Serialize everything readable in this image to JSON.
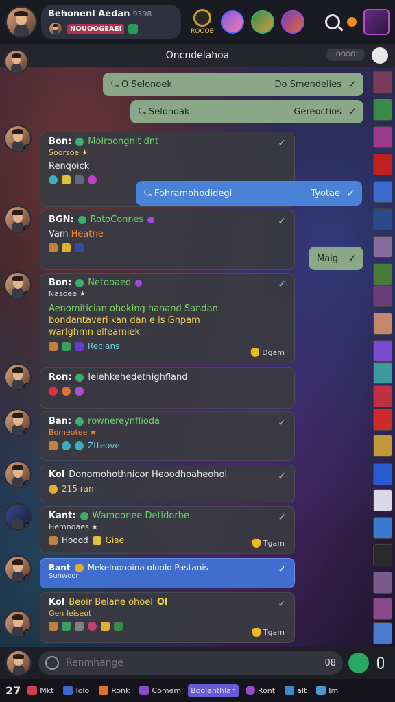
{
  "topbar": {
    "user_name": "Behonenl Aedan",
    "user_number": "9398",
    "user_badge": "NOUOOGEAEI",
    "coin_label": "ROOOB"
  },
  "header": {
    "title": "Oncndelahoa",
    "pill_text": "OOOO"
  },
  "messages": {
    "out1": {
      "left": "O Selonoek",
      "right": "Do Smendelies"
    },
    "out2": {
      "left": "Selonoak",
      "right": "Gereoctios"
    },
    "m1": {
      "name": "Bon:",
      "status": "Molroongnit dnt",
      "sub": "Soorsoe ★",
      "line": "Renqoick"
    },
    "out3": {
      "left": "Fohramohodidegi",
      "right": "Tyotae"
    },
    "m2": {
      "name": "BGN:",
      "status": "RotoConnes",
      "line_label": "Vam",
      "line_value": "Heatne"
    },
    "out4": {
      "text": "Maig"
    },
    "m3": {
      "name": "Bon:",
      "status": "Netooaed",
      "sub": "Nasoee ★",
      "line1": "Aenomitician ohoking hanand Sandan",
      "line2": "bondantaveri kan dan e is",
      "line2b": "Gnpam",
      "line3": "warlghmn elfeamiek",
      "emo_label": "Recians",
      "time": "Dgam"
    },
    "m4": {
      "name": "Ron:",
      "status": "leiehkehedetnighfland"
    },
    "m5": {
      "name": "Ban:",
      "status": "rownereynflioda",
      "sub": "Bomeotee ★",
      "emo_label": "Ztteove"
    },
    "m6": {
      "name": "Kol",
      "text": "Donomohothnicor Heoodhoaheohol",
      "sub": "215 ran"
    },
    "m7": {
      "name": "Kant:",
      "status": "Wamoonee Detidorbe",
      "sub": "Hemnoaes ★",
      "emo_label_a": "Hoood",
      "emo_label_b": "Giae",
      "time": "Tgam"
    },
    "m8": {
      "name": "Bant",
      "text": "Mekelnonoina oloolo Pastanis",
      "sub": "Sunwoor"
    },
    "m9": {
      "name": "Kol",
      "status": "Beoir Belane ohoel",
      "status_tail": "OI",
      "sub": "Gen Ieiseot",
      "time": "Tgam"
    }
  },
  "input": {
    "placeholder": "Renmhange",
    "count": "08"
  },
  "nav": {
    "items": [
      {
        "label": "Mkt"
      },
      {
        "label": "Iolo"
      },
      {
        "label": "Ronk"
      },
      {
        "label": "Comem"
      },
      {
        "label": "Boolenthlan"
      },
      {
        "label": "Ront"
      },
      {
        "label": "alt"
      },
      {
        "label": "Im"
      }
    ]
  },
  "colors": {
    "accent_green": "#2aa860",
    "bubble_blue": "#4a82d8",
    "bubble_green": "#8aa888",
    "active_nav": "#6a5ad8"
  }
}
